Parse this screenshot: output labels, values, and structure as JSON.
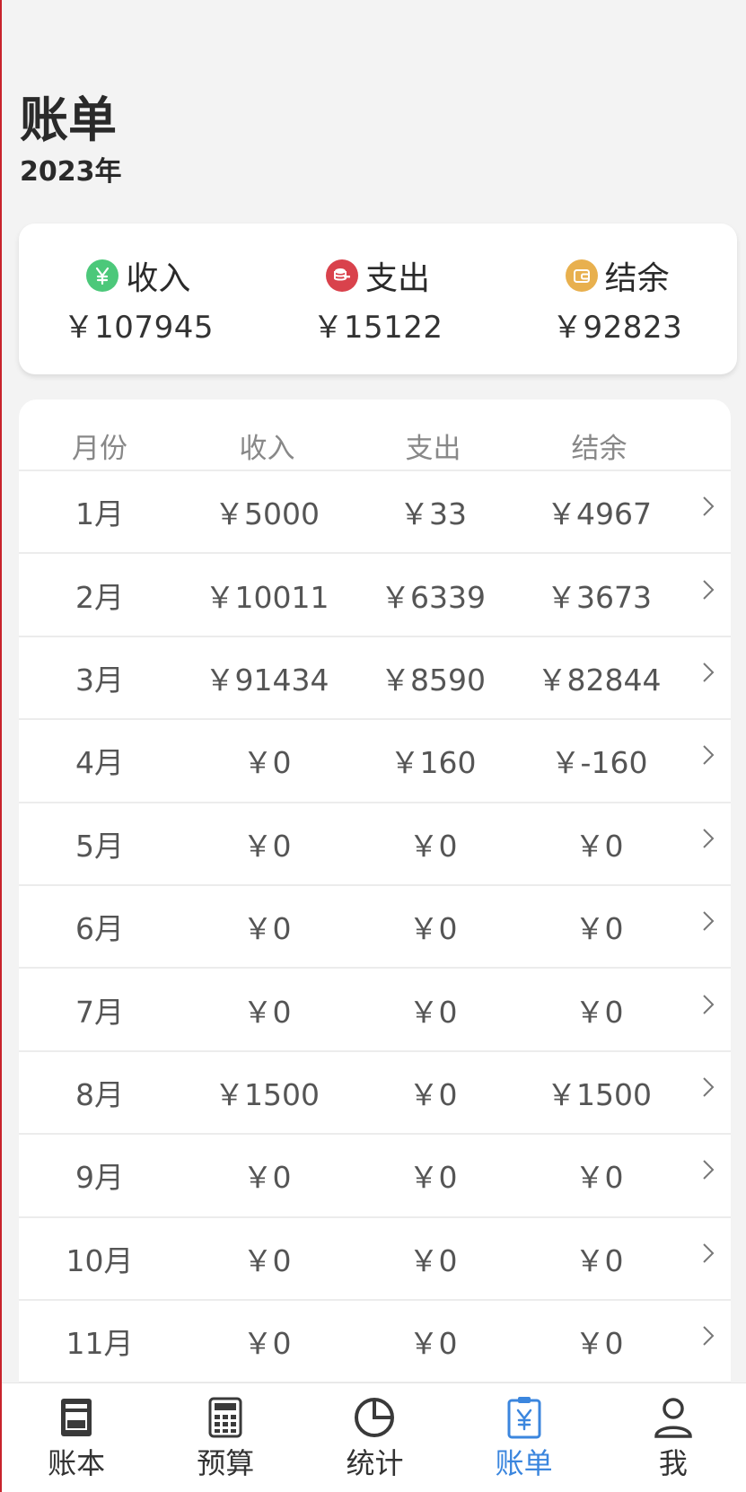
{
  "header": {
    "title": "账单",
    "year": "2023年"
  },
  "summary": {
    "income": {
      "label": "收入",
      "value": "￥107945",
      "color": "#4cc87a"
    },
    "expense": {
      "label": "支出",
      "value": "￥15122",
      "color": "#d9424c"
    },
    "balance": {
      "label": "结余",
      "value": "￥92823",
      "color": "#e8b04e"
    }
  },
  "table": {
    "headers": [
      "月份",
      "收入",
      "支出",
      "结余"
    ],
    "rows": [
      {
        "month": "1月",
        "income": "￥5000",
        "expense": "￥33",
        "balance": "￥4967"
      },
      {
        "month": "2月",
        "income": "￥10011",
        "expense": "￥6339",
        "balance": "￥3673"
      },
      {
        "month": "3月",
        "income": "￥91434",
        "expense": "￥8590",
        "balance": "￥82844"
      },
      {
        "month": "4月",
        "income": "￥0",
        "expense": "￥160",
        "balance": "￥-160"
      },
      {
        "month": "5月",
        "income": "￥0",
        "expense": "￥0",
        "balance": "￥0"
      },
      {
        "month": "6月",
        "income": "￥0",
        "expense": "￥0",
        "balance": "￥0"
      },
      {
        "month": "7月",
        "income": "￥0",
        "expense": "￥0",
        "balance": "￥0"
      },
      {
        "month": "8月",
        "income": "￥1500",
        "expense": "￥0",
        "balance": "￥1500"
      },
      {
        "month": "9月",
        "income": "￥0",
        "expense": "￥0",
        "balance": "￥0"
      },
      {
        "month": "10月",
        "income": "￥0",
        "expense": "￥0",
        "balance": "￥0"
      },
      {
        "month": "11月",
        "income": "￥0",
        "expense": "￥0",
        "balance": "￥0"
      }
    ]
  },
  "tabbar": {
    "items": [
      {
        "label": "账本",
        "icon": "ledger-book-icon"
      },
      {
        "label": "预算",
        "icon": "calculator-icon"
      },
      {
        "label": "统计",
        "icon": "pie-chart-icon"
      },
      {
        "label": "账单",
        "icon": "bill-clipboard-icon"
      },
      {
        "label": "我",
        "icon": "user-profile-icon"
      }
    ],
    "active_index": 3,
    "active_color": "#3b86de"
  }
}
